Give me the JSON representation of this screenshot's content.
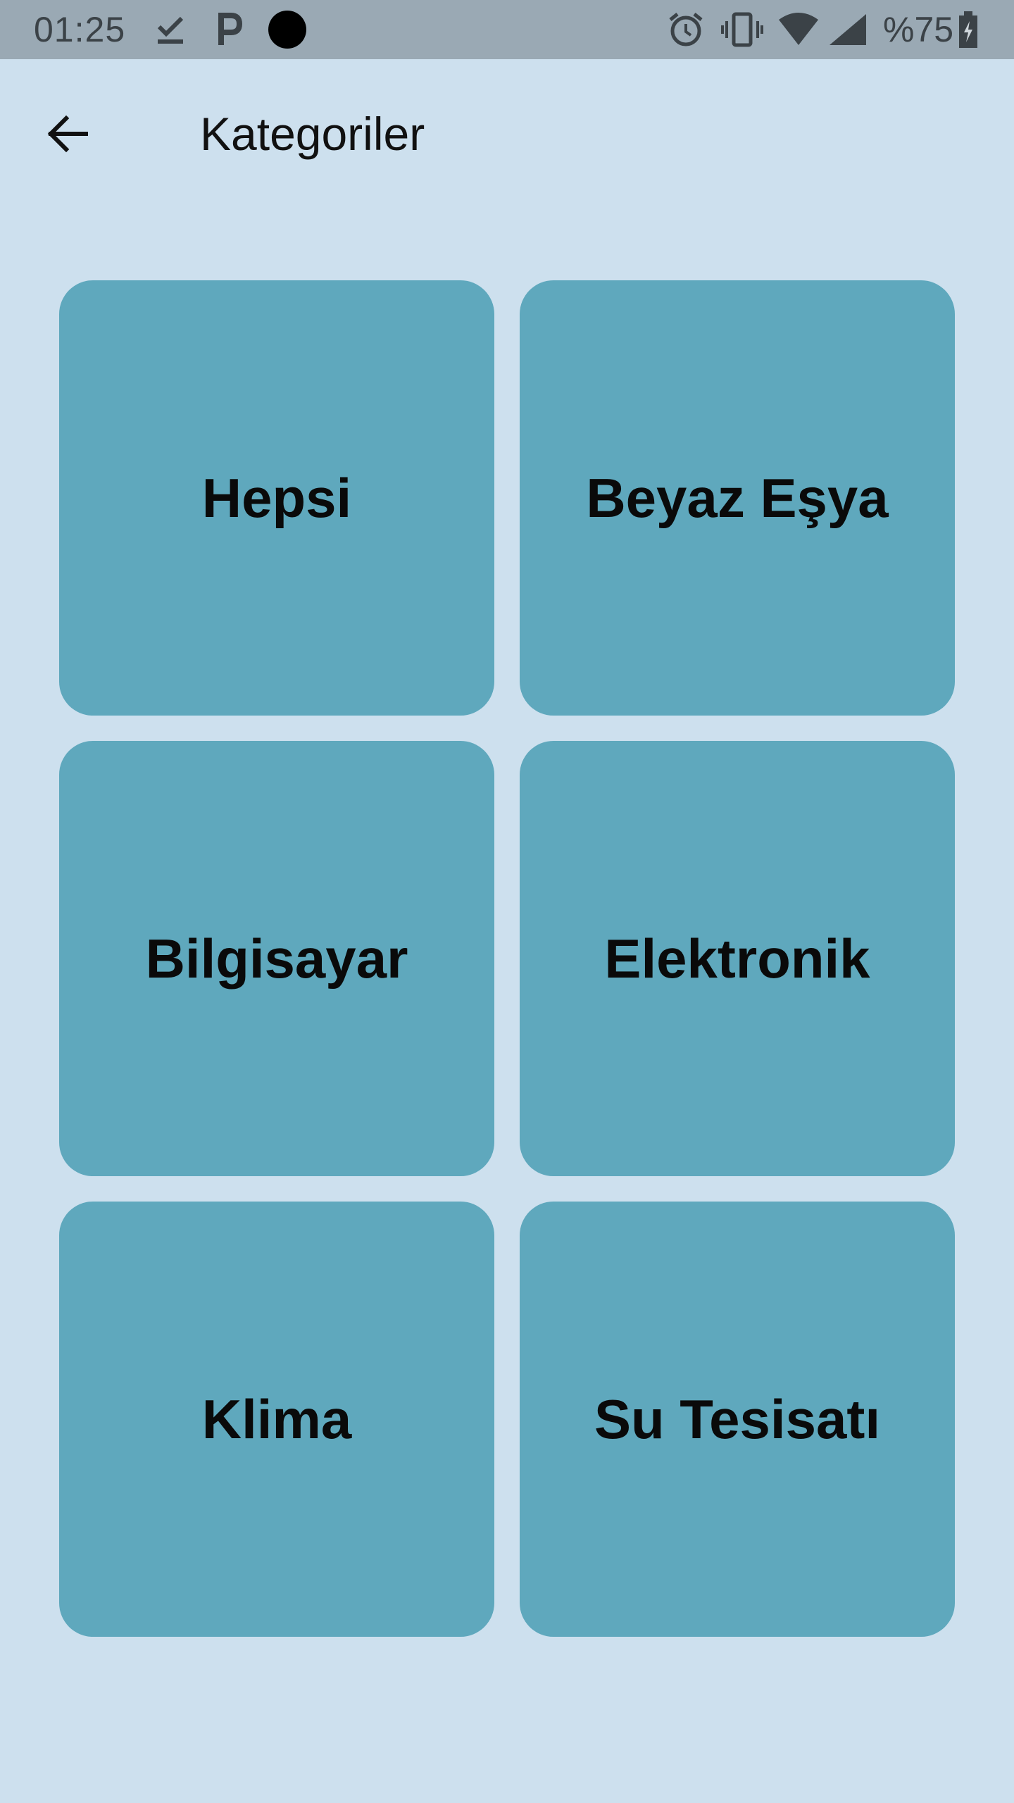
{
  "status_bar": {
    "time": "01:25",
    "battery_text": "%75",
    "icons": [
      "download-done-icon",
      "parking-icon",
      "record-dot-icon",
      "alarm-icon",
      "vibrate-icon",
      "wifi-icon",
      "signal-icon",
      "battery-charging-icon"
    ]
  },
  "app_bar": {
    "back_icon": "arrow-back-icon",
    "title": "Kategoriler"
  },
  "categories": [
    {
      "label": "Hepsi"
    },
    {
      "label": "Beyaz Eşya"
    },
    {
      "label": "Bilgisayar"
    },
    {
      "label": "Elektronik"
    },
    {
      "label": "Klima"
    },
    {
      "label": "Su Tesisatı"
    }
  ],
  "colors": {
    "background": "#cde0ee",
    "status_bar": "#9aa9b4",
    "tile": "#5fa8bd",
    "text": "#0a0a0a"
  }
}
